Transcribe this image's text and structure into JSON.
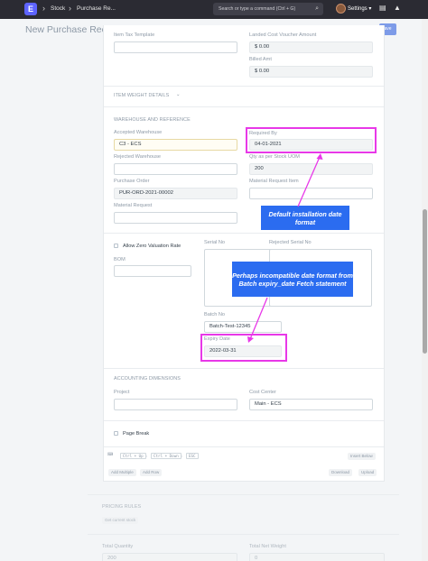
{
  "navbar": {
    "logo_letter": "E",
    "breadcrumbs": [
      "Stock",
      "Purchase Re..."
    ],
    "search_placeholder": "Search or type a command (Ctrl + G)",
    "settings_label": "Settings ▾"
  },
  "page": {
    "title": "New Purchase Receip",
    "save_label": "ave"
  },
  "top_fields": {
    "item_tax_template_label": "Item Tax Template",
    "landed_cost_label": "Landed Cost Voucher Amount",
    "landed_cost_value": "$ 0.00",
    "billed_amt_label": "Billed Amt",
    "billed_amt_value": "$ 0.00"
  },
  "item_weight_section": "ITEM WEIGHT DETAILS",
  "warehouse_section": {
    "title": "WAREHOUSE AND REFERENCE",
    "accepted_warehouse_label": "Accepted Warehouse",
    "accepted_warehouse_value": "C3 - ECS",
    "required_by_label": "Required By",
    "required_by_value": "04-01-2021",
    "rejected_warehouse_label": "Rejected Warehouse",
    "qty_stock_uom_label": "Qty as per Stock UOM",
    "qty_stock_uom_value": "200",
    "purchase_order_label": "Purchase Order",
    "purchase_order_value": "PUR-ORD-2021-00002",
    "material_request_item_label": "Material Request Item",
    "material_request_label": "Material Request"
  },
  "callout_1": "Default installation date format",
  "batch_section": {
    "allow_zero_label": "Allow Zero Valuation Rate",
    "serial_no_label": "Serial No",
    "rejected_serial_no_label": "Rejected Serial No",
    "bom_label": "BOM",
    "batch_no_label": "Batch No",
    "batch_no_value": "Batch-Test-12345",
    "expiry_date_label": "Expiry Date",
    "expiry_date_value": "2022-03-31"
  },
  "callout_2": "Perhaps incompatible date format from Batch expiry_date Fetch statement",
  "accounting_section": {
    "title": "ACCOUNTING DIMENSIONS",
    "project_label": "Project",
    "cost_center_label": "Cost Center",
    "cost_center_value": "Main - ECS"
  },
  "page_break_label": "Page Break",
  "shortcuts": {
    "keys": [
      "Ctrl + Up",
      "Ctrl + Down",
      "ESC"
    ],
    "insert_below": "Insert Below"
  },
  "grid_buttons": {
    "add_multiple": "Add Multiple",
    "add_row": "Add Row",
    "download": "Download",
    "upload": "Upload"
  },
  "pricing": {
    "title": "PRICING RULES",
    "get_current_stock": "Get current stock"
  },
  "totals": {
    "total_quantity_label": "Total Quantity",
    "total_quantity_value": "200",
    "total_net_weight_label": "Total Net Weight",
    "total_net_weight_value": "0"
  },
  "colors": {
    "navbar": "#2b2b33",
    "brand": "#5e64ff",
    "highlight": "#e838e8",
    "callout": "#2b6cf0"
  }
}
